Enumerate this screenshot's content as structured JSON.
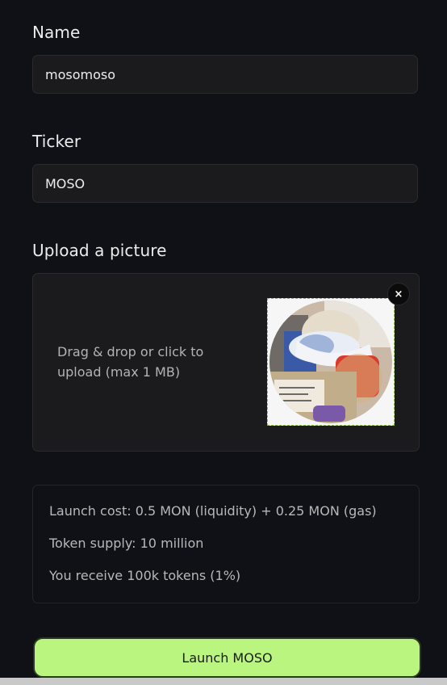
{
  "form": {
    "name_label": "Name",
    "name_value": "mosomoso",
    "ticker_label": "Ticker",
    "ticker_value": "MOSO",
    "upload_label": "Upload a picture",
    "upload_hint": "Drag & drop or click to upload (max 1 MB)",
    "remove_symbol": "×"
  },
  "info": {
    "launch_cost": "Launch cost: 0.5 MON (liquidity) + 0.25 MON (gas)",
    "token_supply": "Token supply: 10 million",
    "receive": "You receive 100k tokens (1%)"
  },
  "launch_button_label": "Launch MOSO",
  "colors": {
    "background": "#0f1117",
    "field_bg": "#1b1b1d",
    "accent": "#b9f57f"
  }
}
